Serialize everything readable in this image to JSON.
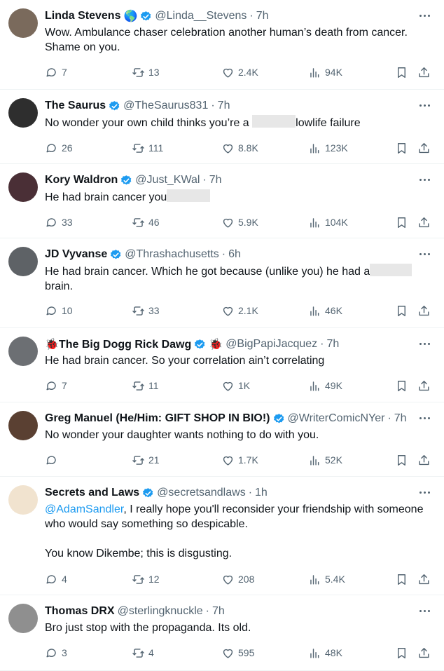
{
  "tweets": [
    {
      "name": "Linda Stevens",
      "emoji": "🌎",
      "handle": "@Linda__Stevens",
      "time": "7h",
      "text_parts": [
        {
          "t": "Wow. Ambulance chaser celebration another human’s death from cancer. Shame on you."
        }
      ],
      "replies": "7",
      "retweets": "13",
      "likes": "2.4K",
      "views": "94K",
      "avatar_color": "#7a6a5c"
    },
    {
      "name": "The Saurus",
      "handle": "@TheSaurus831",
      "time": "7h",
      "text_parts": [
        {
          "t": "No wonder your own child thinks you’re a "
        },
        {
          "redact": true,
          "w": 62
        },
        {
          "t": "lowlife failure"
        }
      ],
      "replies": "26",
      "retweets": "111",
      "likes": "8.8K",
      "views": "123K",
      "avatar_color": "#2e2e2e"
    },
    {
      "name": "Kory Waldron",
      "handle": "@Just_KWal",
      "time": "7h",
      "text_parts": [
        {
          "t": "He had brain cancer you"
        },
        {
          "redact": true,
          "w": 62
        }
      ],
      "replies": "33",
      "retweets": "46",
      "likes": "5.9K",
      "views": "104K",
      "avatar_color": "#4a2f36"
    },
    {
      "name": "JD Vyvanse",
      "handle": "@Thrashachusetts",
      "time": "6h",
      "text_parts": [
        {
          "t": "He had brain cancer. Which he got because (unlike you) he had a"
        },
        {
          "redact": true,
          "w": 60
        },
        {
          "t": " brain."
        }
      ],
      "replies": "10",
      "retweets": "33",
      "likes": "2.1K",
      "views": "46K",
      "avatar_color": "#5e6266"
    },
    {
      "name": "🐞The Big Dogg Rick Dawg",
      "emoji": "🐞",
      "handle": "@BigPapiJacquez",
      "time": "7h",
      "text_parts": [
        {
          "t": "He had brain cancer. So your correlation ain’t correlating"
        }
      ],
      "replies": "7",
      "retweets": "11",
      "likes": "1K",
      "views": "49K",
      "avatar_color": "#6c6f73"
    },
    {
      "name": "Greg Manuel (He/Him: GIFT SHOP IN BIO!)",
      "handle": "@WriterComicNYer",
      "time": "7h",
      "text_parts": [
        {
          "t": "No wonder your daughter wants nothing to do with you."
        }
      ],
      "replies": "",
      "retweets": "21",
      "likes": "1.7K",
      "views": "52K",
      "avatar_color": "#5a4032"
    },
    {
      "name": "Secrets and Laws",
      "handle": "@secretsandlaws",
      "time": "1h",
      "text_parts": [
        {
          "t": "@AdamSandler",
          "mention": true
        },
        {
          "t": ", I really hope you'll reconsider your friendship with someone who would say something so despicable.\n\nYou know Dikembe; this is disgusting."
        }
      ],
      "replies": "4",
      "retweets": "12",
      "likes": "208",
      "views": "5.4K",
      "avatar_color": "#f1e3cf"
    },
    {
      "name": "Thomas DRX",
      "handle": "@sterlingknuckle",
      "time": "7h",
      "text_parts": [
        {
          "t": "Bro just stop with the propaganda. Its old."
        }
      ],
      "replies": "3",
      "retweets": "4",
      "likes": "595",
      "views": "48K",
      "avatar_color": "#8f8f8f"
    }
  ],
  "colors": {
    "accent": "#1d9bf0",
    "text": "#0f1419",
    "muted": "#536471"
  },
  "icons": [
    "more-icon",
    "verified-icon",
    "reply-icon",
    "retweet-icon",
    "like-icon",
    "views-icon",
    "bookmark-icon",
    "share-icon"
  ]
}
